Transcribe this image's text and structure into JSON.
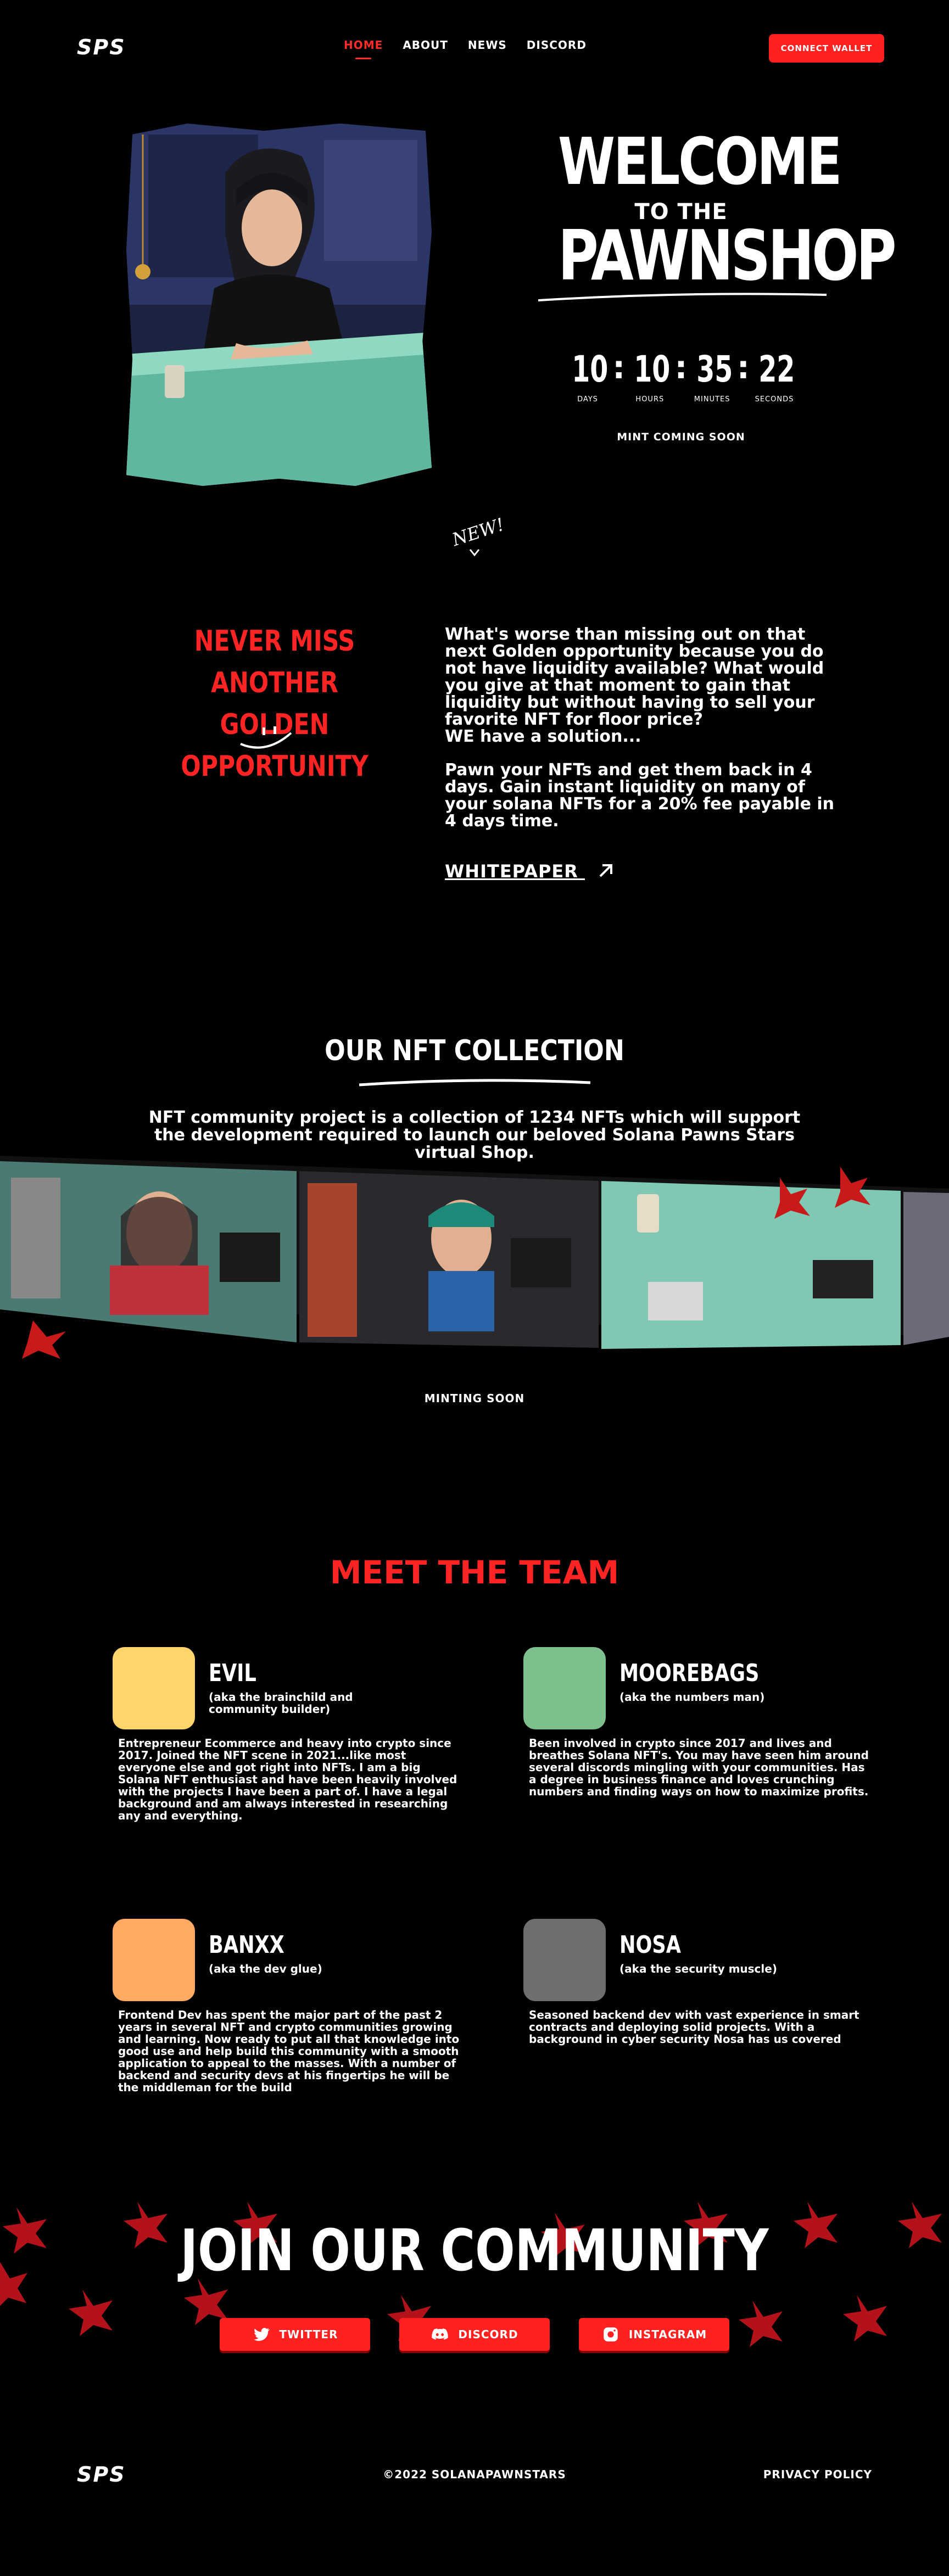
{
  "nav": {
    "logo": "SPS",
    "links": [
      {
        "label": "HOME",
        "active": true
      },
      {
        "label": "ABOUT"
      },
      {
        "label": "NEWS"
      },
      {
        "label": "DISCORD"
      }
    ],
    "connect_label": "CONNECT WALLET"
  },
  "hero": {
    "welcome": "WELCOME",
    "to_the": "TO THE",
    "pawnshop": "PAWNSHOP",
    "timer": [
      {
        "value": "10",
        "label": "DAYS"
      },
      {
        "value": "10",
        "label": "HOURS"
      },
      {
        "value": "35",
        "label": "MINUTES"
      },
      {
        "value": "22",
        "label": "SECONDS"
      }
    ],
    "mint_status": "MINT COMING SOON",
    "new_note": "NEW!"
  },
  "about": {
    "headline_1": "NEVER MISS ANOTHER",
    "headline_2": "GOLDEN OPPORTUNITY",
    "para_1": "What's worse than missing out on that next Golden opportunity because you do not have liquidity available? What would you give at that moment to gain that liquidity but without having to sell your favorite NFT for floor price?\nWE have a solution...",
    "para_2": "Pawn your NFTs and get them back in 4 days. Gain instant liquidity on many of your solana NFTs for a 20% fee payable in 4 days time.",
    "whitepaper": "WHITEPAPER"
  },
  "collection": {
    "title": "OUR NFT COLLECTION",
    "desc": "NFT community project is a collection of 1234 NFTs which will support the development required to launch our beloved Solana Pawns Stars virtual Shop.",
    "minting": "MINTING SOON"
  },
  "team": {
    "title": "MEET THE TEAM",
    "members": [
      {
        "name": "EVIL",
        "aka": "(aka the brainchild and community builder)",
        "color": "#ffd56b",
        "bio": "Entrepreneur Ecommerce and heavy into crypto since 2017. Joined the NFT scene in 2021...like most everyone else and got right into NFTs. I am a big Solana NFT enthusiast and have been heavily involved with the projects I have been a part of. I have a legal background and am always interested in researching any and everything."
      },
      {
        "name": "MOOREBAGS",
        "aka": "(aka the numbers man)",
        "color": "#7dc08d",
        "bio": "Been involved in crypto since 2017 and lives and breathes Solana NFT's. You may have seen him around several discords mingling with your communities. Has a degree in business finance and loves crunching numbers and finding ways on how to maximize profits."
      },
      {
        "name": "BANXX",
        "aka": "(aka the dev glue)",
        "color": "#ffa962",
        "bio": "Frontend Dev has spent the major part of the past 2 years in several NFT and crypto communities growing and learning. Now ready to put all that knowledge into good use and help build this community with a smooth application to appeal to the masses. With a number of backend and security devs at his fingertips he will be the middleman for the build"
      },
      {
        "name": "NOSA",
        "aka": "(aka the security muscle)",
        "color": "#6e6e6e",
        "bio": "Seasoned backend dev with vast experience in smart contracts and deploying solid projects. With a background in cyber security Nosa has us covered"
      }
    ]
  },
  "community": {
    "title": "JOIN OUR COMMUNITY",
    "twitter": "TWITTER",
    "discord": "DISCORD",
    "instagram": "INSTAGRAM"
  },
  "footer": {
    "logo": "SPS",
    "copyright": "©2022 SOLANAPAWNSTARS",
    "privacy": "PRIVACY POLICY"
  },
  "colors": {
    "accent": "#ff2020",
    "background": "#000000"
  }
}
